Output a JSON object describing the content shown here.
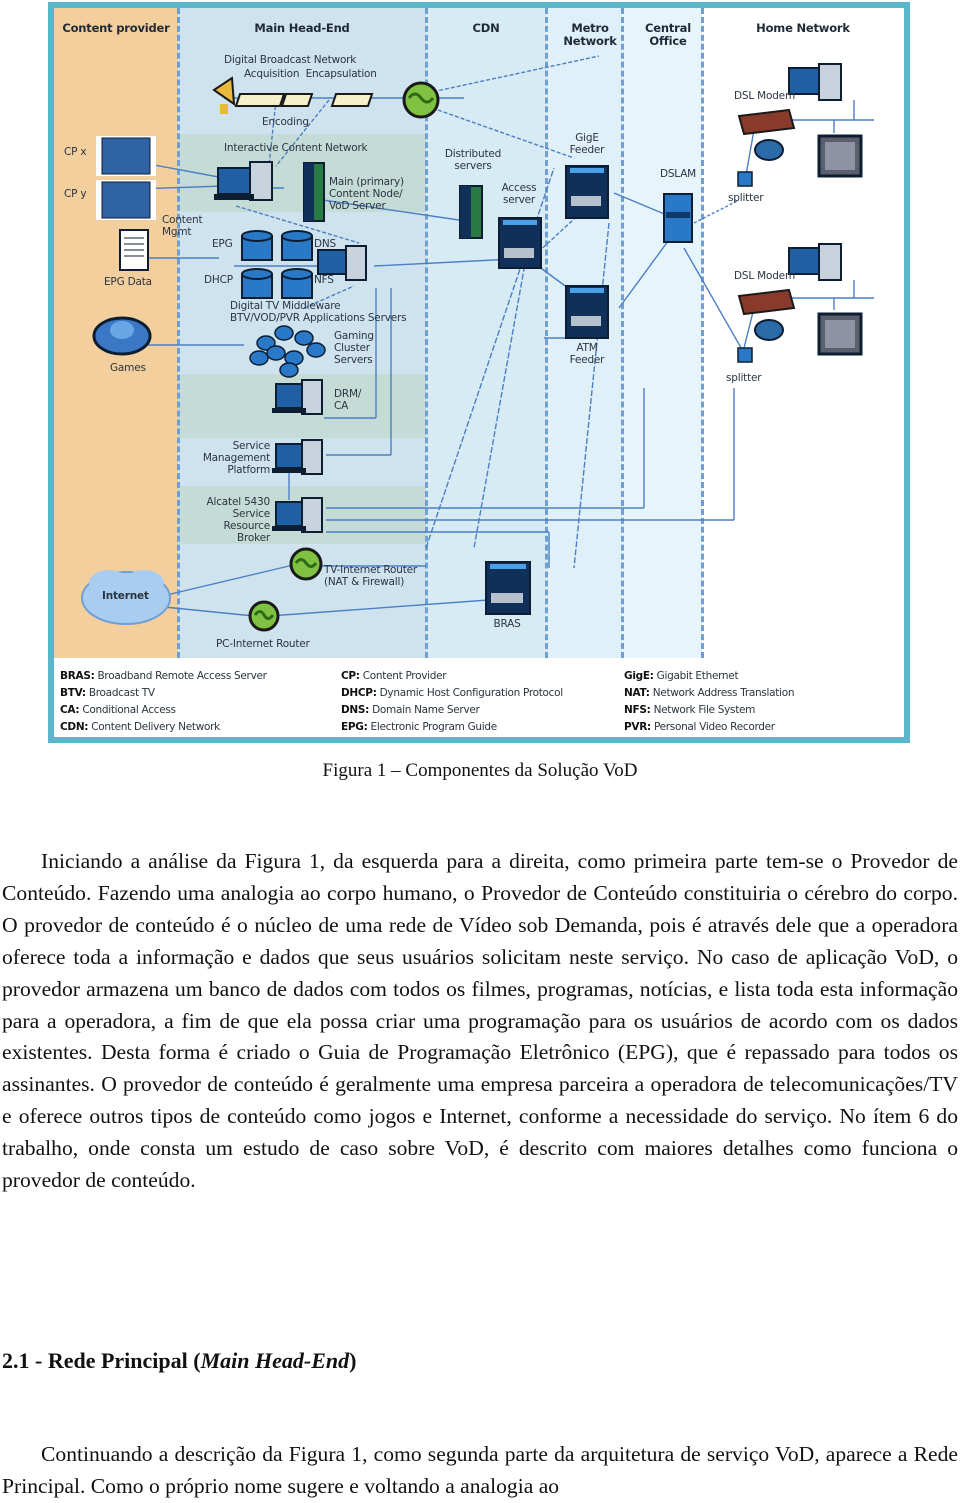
{
  "figure": {
    "columns": [
      {
        "id": "content-provider",
        "title": "Content provider"
      },
      {
        "id": "main-head-end",
        "title": "Main Head-End"
      },
      {
        "id": "cdn",
        "title": "CDN"
      },
      {
        "id": "metro-network",
        "title": "Metro Network"
      },
      {
        "id": "central-office",
        "title": "Central Office"
      },
      {
        "id": "home-network",
        "title": "Home Network"
      }
    ],
    "labels": {
      "dbn": "Digital Broadcast Network",
      "acquisition_encapsulation": "Acquisition  Encapsulation",
      "encoding": "Encoding",
      "icn": "Interactive Content Network",
      "cpx": "CP x",
      "cpy": "CP y",
      "main_node_1": "Main (primary)",
      "main_node_2": "Content Node/",
      "main_node_3": "VoD Server",
      "content_mgmt_1": "Content",
      "content_mgmt_2": "Mgmt",
      "epg": "EPG",
      "dns": "DNS",
      "dhcp": "DHCP",
      "nfs": "NFS",
      "epg_data": "EPG Data",
      "middleware_1": "Digital TV Middleware",
      "middleware_2": "BTV/VOD/PVR Applications Servers",
      "gaming_1": "Gaming",
      "gaming_2": "Cluster",
      "gaming_3": "Servers",
      "games": "Games",
      "drm_1": "DRM/",
      "drm_2": "CA",
      "smp_1": "Service",
      "smp_2": "Management",
      "smp_3": "Platform",
      "srb_1": "Alcatel 5430",
      "srb_2": "Service",
      "srb_3": "Resource",
      "srb_4": "Broker",
      "tv_router_1": "TV-Internet Router",
      "tv_router_2": "(NAT & Firewall)",
      "internet": "Internet",
      "pc_router": "PC-Internet Router",
      "distributed_1": "Distributed",
      "distributed_2": "servers",
      "access_1": "Access",
      "access_2": "server",
      "gige_1": "GigE",
      "gige_2": "Feeder",
      "atm_1": "ATM",
      "atm_2": "Feeder",
      "bras": "BRAS",
      "dslam": "DSLAM",
      "dsl_modem_1": "DSL Modem",
      "dsl_modem_2": "DSL Modem",
      "splitter_1": "splitter",
      "splitter_2": "splitter"
    },
    "legend": [
      [
        {
          "abbr": "BRAS:",
          "text": " Broadband Remote Access Server"
        },
        {
          "abbr": "BTV:",
          "text": " Broadcast TV"
        },
        {
          "abbr": "CA:",
          "text": " Conditional Access"
        },
        {
          "abbr": "CDN:",
          "text": " Content Delivery Network"
        }
      ],
      [
        {
          "abbr": "CP:",
          "text": " Content Provider"
        },
        {
          "abbr": "DHCP:",
          "text": " Dynamic Host Configuration Protocol"
        },
        {
          "abbr": "DNS:",
          "text": " Domain Name Server"
        },
        {
          "abbr": "EPG:",
          "text": " Electronic Program Guide"
        }
      ],
      [
        {
          "abbr": "GigE:",
          "text": " Gigabit Ethernet"
        },
        {
          "abbr": "NAT:",
          "text": " Network Address Translation"
        },
        {
          "abbr": "NFS:",
          "text": " Network File System"
        },
        {
          "abbr": "PVR:",
          "text": " Personal Video Recorder"
        }
      ]
    ],
    "colors": {
      "frame": "#5bb6cc",
      "content_provider": "#f2cf9d",
      "main_head_end": "#cfe3ef",
      "band": "#c5dcd6",
      "wire": "#4d7fc4",
      "device_dark": "#10305a",
      "device_blue": "#2a78c8",
      "router_green": "#7fc241"
    }
  },
  "caption": "Figura 1 – Componentes da Solução VoD",
  "paragraph1": "Iniciando a análise da Figura 1, da esquerda para a direita, como primeira parte tem-se o Provedor de Conteúdo. Fazendo uma analogia ao corpo humano, o Provedor de Conteúdo constituiria o cérebro do corpo. O provedor de conteúdo é o núcleo de uma rede de Vídeo sob Demanda, pois é através dele que a operadora oferece toda a informação e dados que seus usuários solicitam neste serviço. No caso de aplicação VoD, o provedor armazena um banco de dados com todos os filmes, programas, notícias, e lista toda esta informação para a operadora, a fim de que ela possa criar uma programação para os usuários de acordo com os dados existentes. Desta forma é criado o Guia de Programação Eletrônico (EPG), que é repassado para todos os assinantes. O provedor de conteúdo é geralmente uma empresa parceira a operadora de telecomunicações/TV e oferece outros tipos de conteúdo como jogos e Internet, conforme a necessidade do serviço. No ítem 6 do trabalho, onde consta um estudo de caso sobre VoD, é descrito com maiores detalhes como funciona o provedor de conteúdo.",
  "heading": {
    "number": "2.1 - Rede Principal (",
    "italic": "Main Head-End",
    "close": ")"
  },
  "paragraph2": "Continuando a descrição da Figura 1, como segunda parte da arquitetura de serviço VoD, aparece a Rede Principal. Como o próprio nome sugere e voltando a analogia ao"
}
